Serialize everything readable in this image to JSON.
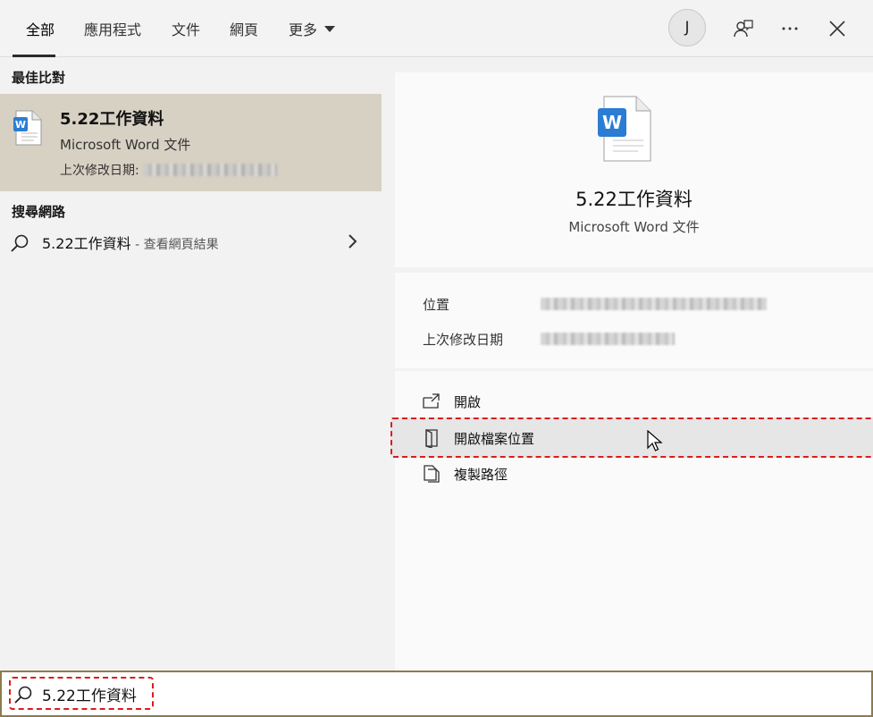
{
  "tabs": [
    {
      "label": "全部",
      "active": true
    },
    {
      "label": "應用程式"
    },
    {
      "label": "文件"
    },
    {
      "label": "網頁"
    },
    {
      "label": "更多"
    }
  ],
  "header": {
    "avatar_initial": "J",
    "more_menu_icon": "ellipsis-icon",
    "feedback_icon": "feedback-icon",
    "close_icon": "close-icon"
  },
  "left": {
    "best_match_label": "最佳比對",
    "best_match": {
      "title": "5.22工作資料",
      "type": "Microsoft Word 文件",
      "modified_label": "上次修改日期:"
    },
    "web_label": "搜尋網路",
    "web_result": {
      "query": "5.22工作資料",
      "hint": " - 查看網頁結果"
    }
  },
  "detail": {
    "title": "5.22工作資料",
    "type": "Microsoft Word 文件",
    "location_label": "位置",
    "modified_label": "上次修改日期"
  },
  "actions": [
    {
      "label": "開啟",
      "icon": "open-icon"
    },
    {
      "label": "開啟檔案位置",
      "icon": "folder-icon"
    },
    {
      "label": "複製路徑",
      "icon": "copy-icon"
    }
  ],
  "search": {
    "query": "5.22工作資料"
  },
  "colors": {
    "highlight_border": "#d81e1e",
    "best_match_bg": "#d7d1c4",
    "search_border": "#8d7b4a",
    "word_blue": "#2b7cd3"
  }
}
